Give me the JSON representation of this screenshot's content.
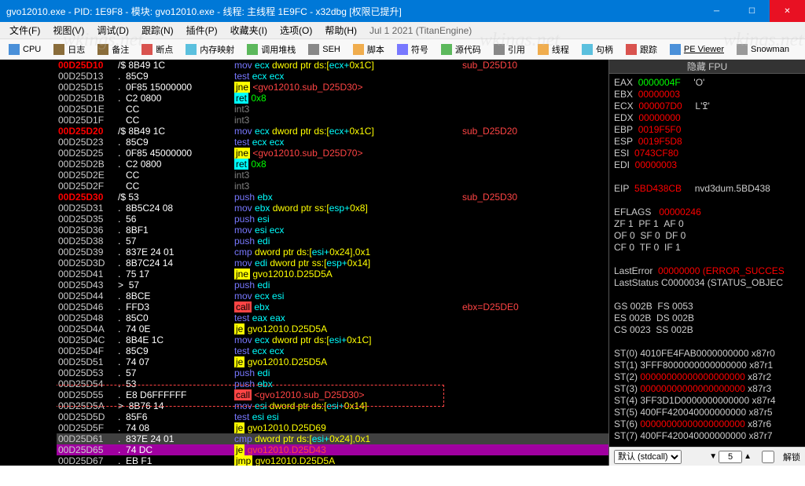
{
  "title": "gvo12010.exe - PID: 1E9F8 - 模块: gvo12010.exe - 线程: 主线程 1E9FC - x32dbg [权限已提升]",
  "menus": [
    "文件(F)",
    "视图(V)",
    "调试(D)",
    "跟踪(N)",
    "插件(P)",
    "收藏夹(I)",
    "选项(O)",
    "帮助(H)"
  ],
  "engine": "Jul 1 2021 (TitanEngine)",
  "watermarks": [
    "wkings.net",
    "wkings.net",
    "wkings.net"
  ],
  "toolbar": [
    {
      "label": "CPU",
      "icon": "#4a90d9"
    },
    {
      "label": "日志",
      "icon": "#8a6d3b"
    },
    {
      "label": "备注",
      "icon": "#8a6d3b"
    },
    {
      "label": "断点",
      "icon": "#d9534f"
    },
    {
      "label": "内存映射",
      "icon": "#5bc0de"
    },
    {
      "label": "调用堆栈",
      "icon": "#5cb85c"
    },
    {
      "label": "SEH",
      "icon": "#888"
    },
    {
      "label": "脚本",
      "icon": "#f0ad4e"
    },
    {
      "label": "符号",
      "icon": "#7878ff"
    },
    {
      "label": "源代码",
      "icon": "#5cb85c"
    },
    {
      "label": "引用",
      "icon": "#888"
    },
    {
      "label": "线程",
      "icon": "#f0ad4e"
    },
    {
      "label": "句柄",
      "icon": "#5bc0de"
    },
    {
      "label": "跟踪",
      "icon": "#d9534f"
    },
    {
      "label": "PE Viewer",
      "icon": "#4a90d9",
      "under": true
    },
    {
      "label": "Snowman",
      "icon": "#999"
    }
  ],
  "fpu_header": "隐藏 FPU",
  "regs": [
    {
      "n": "EAX",
      "v": "0000004F",
      "hl": true,
      "c": "'O'"
    },
    {
      "n": "EBX",
      "v": "00000003",
      "c": ""
    },
    {
      "n": "ECX",
      "v": "000007D0",
      "c": "L'ߐ'"
    },
    {
      "n": "EDX",
      "v": "00000000",
      "c": ""
    },
    {
      "n": "EBP",
      "v": "0019F5F0",
      "c": ""
    },
    {
      "n": "ESP",
      "v": "0019F5D8",
      "c": ""
    },
    {
      "n": "ESI",
      "v": "0743CF80",
      "c": ""
    },
    {
      "n": "EDI",
      "v": "00000003",
      "c": ""
    }
  ],
  "eip": {
    "n": "EIP",
    "v": "5BD438CB",
    "c": "nvd3dum.5BD438"
  },
  "eflags": "EFLAGS   00000246",
  "flags": [
    "ZF 1  PF 1  AF 0",
    "OF 0  SF 0  DF 0",
    "CF 0  TF 0  IF 1"
  ],
  "lasterror": {
    "n": "LastError",
    "v": "00000000 (ERROR_SUCCES"
  },
  "laststatus": {
    "n": "LastStatus",
    "v": "C0000034 (STATUS_OBJEC"
  },
  "segments": [
    "GS 002B  FS 0053",
    "ES 002B  DS 002B",
    "CS 0023  SS 002B"
  ],
  "st": [
    {
      "n": "ST(0)",
      "v": "4010FE4FAB0000000000",
      "t": "x87r0",
      "w": true
    },
    {
      "n": "ST(1)",
      "v": "3FFF8000000000000000",
      "t": "x87r1",
      "w": true
    },
    {
      "n": "ST(2)",
      "v": "00000000000000000000",
      "t": "x87r2"
    },
    {
      "n": "ST(3)",
      "v": "00000000000000000000",
      "t": "x87r3"
    },
    {
      "n": "ST(4)",
      "v": "3FF3D1D0000000000000",
      "t": "x87r4",
      "w": true
    },
    {
      "n": "ST(5)",
      "v": "400FF420040000000000",
      "t": "x87r5",
      "w": true
    },
    {
      "n": "ST(6)",
      "v": "00000000000000000000",
      "t": "x87r6"
    },
    {
      "n": "ST(7)",
      "v": "400FF420040000000000",
      "t": "x87r7",
      "w": true
    }
  ],
  "status": {
    "calling": "默认 (stdcall)",
    "spin": "5",
    "unlock": "解锁"
  },
  "rows": [
    {
      "a": "00D25D10",
      "ar": true,
      "p": "/$",
      "b": "8B49 1C",
      "asm": [
        [
          "mov",
          "mov"
        ],
        [
          " ",
          "n"
        ],
        [
          "ecx",
          "reg"
        ],
        [
          ",",
          "n"
        ],
        [
          "dword ptr ds:[",
          "ptr"
        ],
        [
          "ecx+",
          "reg"
        ],
        [
          "0x1C",
          "num"
        ],
        [
          "]",
          "ptr"
        ]
      ],
      "c": "sub_D25D10"
    },
    {
      "a": "00D25D13",
      "p": ".",
      "b": "85C9",
      "asm": [
        [
          "test",
          "test"
        ],
        [
          " ",
          "n"
        ],
        [
          "ecx",
          "reg"
        ],
        [
          ",",
          "n"
        ],
        [
          "ecx",
          "reg"
        ]
      ]
    },
    {
      "a": "00D25D15",
      "p": ".",
      "b": "0F85 15000000",
      "asm": [
        [
          "jne",
          "jne"
        ],
        [
          " ",
          "n"
        ],
        [
          "<gvo12010.sub_D25D30>",
          "target"
        ]
      ]
    },
    {
      "a": "00D25D1B",
      "p": ".",
      "b": "C2 0800",
      "asm": [
        [
          "ret",
          "ret"
        ],
        [
          " ",
          "n"
        ],
        [
          "0x8",
          "ptr2"
        ]
      ]
    },
    {
      "a": "00D25D1E",
      "p": "",
      "b": "CC",
      "asm": [
        [
          "int3",
          "int3"
        ]
      ]
    },
    {
      "a": "00D25D1F",
      "p": "",
      "b": "CC",
      "asm": [
        [
          "int3",
          "int3"
        ]
      ]
    },
    {
      "a": "00D25D20",
      "ar": true,
      "p": "/$",
      "b": "8B49 1C",
      "asm": [
        [
          "mov",
          "mov"
        ],
        [
          " ",
          "n"
        ],
        [
          "ecx",
          "reg"
        ],
        [
          ",",
          "n"
        ],
        [
          "dword ptr ds:[",
          "ptr"
        ],
        [
          "ecx+",
          "reg"
        ],
        [
          "0x1C",
          "num"
        ],
        [
          "]",
          "ptr"
        ]
      ],
      "c": "sub_D25D20"
    },
    {
      "a": "00D25D23",
      "p": ".",
      "b": "85C9",
      "asm": [
        [
          "test",
          "test"
        ],
        [
          " ",
          "n"
        ],
        [
          "ecx",
          "reg"
        ],
        [
          ",",
          "n"
        ],
        [
          "ecx",
          "reg"
        ]
      ]
    },
    {
      "a": "00D25D25",
      "p": ".",
      "b": "0F85 45000000",
      "asm": [
        [
          "jne",
          "jne"
        ],
        [
          " ",
          "n"
        ],
        [
          "<gvo12010.sub_D25D70>",
          "target"
        ]
      ]
    },
    {
      "a": "00D25D2B",
      "p": ".",
      "b": "C2 0800",
      "asm": [
        [
          "ret",
          "ret"
        ],
        [
          " ",
          "n"
        ],
        [
          "0x8",
          "ptr2"
        ]
      ]
    },
    {
      "a": "00D25D2E",
      "p": "",
      "b": "CC",
      "asm": [
        [
          "int3",
          "int3"
        ]
      ]
    },
    {
      "a": "00D25D2F",
      "p": "",
      "b": "CC",
      "asm": [
        [
          "int3",
          "int3"
        ]
      ]
    },
    {
      "a": "00D25D30",
      "ar": true,
      "p": "/$",
      "b": "53",
      "asm": [
        [
          "push",
          "push"
        ],
        [
          " ",
          "n"
        ],
        [
          "ebx",
          "reg"
        ]
      ],
      "c": "sub_D25D30"
    },
    {
      "a": "00D25D31",
      "p": ".",
      "b": "8B5C24 08",
      "asm": [
        [
          "mov",
          "mov"
        ],
        [
          " ",
          "n"
        ],
        [
          "ebx",
          "reg"
        ],
        [
          ",",
          "n"
        ],
        [
          "dword ptr ss:[",
          "ptr"
        ],
        [
          "esp+",
          "reg"
        ],
        [
          "0x8",
          "num"
        ],
        [
          "]",
          "ptr"
        ]
      ]
    },
    {
      "a": "00D25D35",
      "p": ".",
      "b": "56",
      "asm": [
        [
          "push",
          "push"
        ],
        [
          " ",
          "n"
        ],
        [
          "esi",
          "reg"
        ]
      ]
    },
    {
      "a": "00D25D36",
      "p": ".",
      "b": "8BF1",
      "asm": [
        [
          "mov",
          "mov"
        ],
        [
          " ",
          "n"
        ],
        [
          "esi",
          "reg"
        ],
        [
          ",",
          "n"
        ],
        [
          "ecx",
          "reg"
        ]
      ]
    },
    {
      "a": "00D25D38",
      "p": ".",
      "b": "57",
      "asm": [
        [
          "push",
          "push"
        ],
        [
          " ",
          "n"
        ],
        [
          "edi",
          "reg"
        ]
      ]
    },
    {
      "a": "00D25D39",
      "p": ".",
      "b": "837E 24 01",
      "asm": [
        [
          "cmp",
          "cmp"
        ],
        [
          " ",
          "n"
        ],
        [
          "dword ptr ds:[",
          "ptr"
        ],
        [
          "esi+",
          "reg"
        ],
        [
          "0x24",
          "num"
        ],
        [
          "],",
          "ptr"
        ],
        [
          "0x1",
          "num"
        ]
      ]
    },
    {
      "a": "00D25D3D",
      "p": ".",
      "b": "8B7C24 14",
      "asm": [
        [
          "mov",
          "mov"
        ],
        [
          " ",
          "n"
        ],
        [
          "edi",
          "reg"
        ],
        [
          ",",
          "n"
        ],
        [
          "dword ptr ss:[",
          "ptr"
        ],
        [
          "esp+",
          "reg"
        ],
        [
          "0x14",
          "num"
        ],
        [
          "]",
          "ptr"
        ]
      ]
    },
    {
      "a": "00D25D41",
      "p": ".",
      "b": "75 17",
      "asm": [
        [
          "jne",
          "jne"
        ],
        [
          " ",
          "n"
        ],
        [
          "gvo12010.D25D5A",
          "target2"
        ]
      ]
    },
    {
      "a": "00D25D43",
      "p": ">",
      "b": "57",
      "asm": [
        [
          "push",
          "push"
        ],
        [
          " ",
          "n"
        ],
        [
          "edi",
          "reg"
        ]
      ]
    },
    {
      "a": "00D25D44",
      "p": ".",
      "b": "8BCE",
      "asm": [
        [
          "mov",
          "mov"
        ],
        [
          " ",
          "n"
        ],
        [
          "ecx",
          "reg"
        ],
        [
          ",",
          "n"
        ],
        [
          "esi",
          "reg"
        ]
      ]
    },
    {
      "a": "00D25D46",
      "p": ".",
      "b": "FFD3",
      "asm": [
        [
          "call",
          "call"
        ],
        [
          " ",
          "n"
        ],
        [
          "ebx",
          "reg"
        ]
      ],
      "c": "ebx=D25DE0"
    },
    {
      "a": "00D25D48",
      "p": ".",
      "b": "85C0",
      "asm": [
        [
          "test",
          "test"
        ],
        [
          " ",
          "n"
        ],
        [
          "eax",
          "reg"
        ],
        [
          ",",
          "n"
        ],
        [
          "eax",
          "reg"
        ]
      ]
    },
    {
      "a": "00D25D4A",
      "p": ".",
      "b": "74 0E",
      "asm": [
        [
          "je",
          "je"
        ],
        [
          " ",
          "n"
        ],
        [
          "gvo12010.D25D5A",
          "target2"
        ]
      ]
    },
    {
      "a": "00D25D4C",
      "p": ".",
      "b": "8B4E 1C",
      "asm": [
        [
          "mov",
          "mov"
        ],
        [
          " ",
          "n"
        ],
        [
          "ecx",
          "reg"
        ],
        [
          ",",
          "n"
        ],
        [
          "dword ptr ds:[",
          "ptr"
        ],
        [
          "esi+",
          "reg"
        ],
        [
          "0x1C",
          "num"
        ],
        [
          "]",
          "ptr"
        ]
      ]
    },
    {
      "a": "00D25D4F",
      "p": ".",
      "b": "85C9",
      "asm": [
        [
          "test",
          "test"
        ],
        [
          " ",
          "n"
        ],
        [
          "ecx",
          "reg"
        ],
        [
          ",",
          "n"
        ],
        [
          "ecx",
          "reg"
        ]
      ]
    },
    {
      "a": "00D25D51",
      "p": ".",
      "b": "74 07",
      "asm": [
        [
          "je",
          "je"
        ],
        [
          " ",
          "n"
        ],
        [
          "gvo12010.D25D5A",
          "target2"
        ]
      ]
    },
    {
      "a": "00D25D53",
      "p": ".",
      "b": "57",
      "asm": [
        [
          "push",
          "push"
        ],
        [
          " ",
          "n"
        ],
        [
          "edi",
          "reg"
        ]
      ]
    },
    {
      "a": "00D25D54",
      "p": ".",
      "b": "53",
      "asm": [
        [
          "push",
          "push"
        ],
        [
          " ",
          "n"
        ],
        [
          "ebx",
          "reg"
        ]
      ]
    },
    {
      "a": "00D25D55",
      "p": ".",
      "b": "E8 D6FFFFFF",
      "asm": [
        [
          "call",
          "call"
        ],
        [
          " ",
          "n"
        ],
        [
          "<gvo12010.sub_D25D30>",
          "target"
        ]
      ]
    },
    {
      "a": "00D25D5A",
      "p": ">",
      "b": "8B76 14",
      "asm": [
        [
          "mov",
          "mov"
        ],
        [
          " ",
          "n"
        ],
        [
          "esi",
          "reg"
        ],
        [
          ",",
          "n"
        ],
        [
          "dword ptr ds:[",
          "ptr"
        ],
        [
          "esi+",
          "reg"
        ],
        [
          "0x14",
          "num"
        ],
        [
          "]",
          "ptr"
        ]
      ]
    },
    {
      "a": "00D25D5D",
      "p": ".",
      "b": "85F6",
      "asm": [
        [
          "test",
          "test"
        ],
        [
          " ",
          "n"
        ],
        [
          "esi",
          "reg"
        ],
        [
          ",",
          "n"
        ],
        [
          "esi",
          "reg"
        ]
      ]
    },
    {
      "a": "00D25D5F",
      "p": ".",
      "b": "74 08",
      "asm": [
        [
          "je",
          "je"
        ],
        [
          " ",
          "n"
        ],
        [
          "gvo12010.D25D69",
          "target2"
        ]
      ]
    },
    {
      "a": "00D25D61",
      "p": ".",
      "b": "837E 24 01",
      "asm": [
        [
          "cmp",
          "cmp"
        ],
        [
          " ",
          "n"
        ],
        [
          "dword ptr ds:[",
          "ptr"
        ],
        [
          "esi+",
          "reg"
        ],
        [
          "0x24",
          "num"
        ],
        [
          "],",
          "ptr"
        ],
        [
          "0x1",
          "num"
        ]
      ],
      "sel2": true
    },
    {
      "a": "00D25D65",
      "p": ".",
      "b": "74 DC",
      "asm": [
        [
          "je",
          "je"
        ],
        [
          " ",
          "n"
        ],
        [
          "gvo12010.D25D43",
          "target"
        ]
      ],
      "sel": true
    },
    {
      "a": "00D25D67",
      "p": ".",
      "b": "EB F1",
      "asm": [
        [
          "jmp",
          "jmp"
        ],
        [
          " ",
          "n"
        ],
        [
          "gvo12010.D25D5A",
          "target2"
        ]
      ]
    }
  ]
}
